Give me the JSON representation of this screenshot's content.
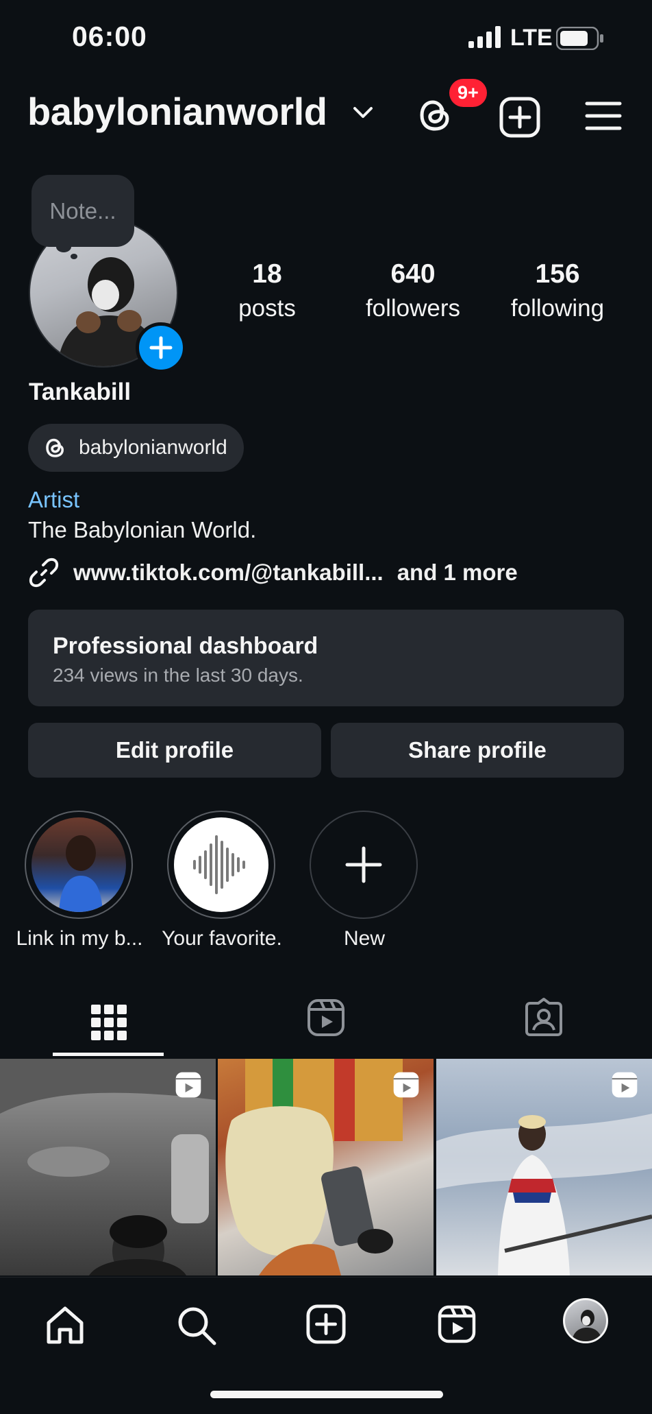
{
  "status_bar": {
    "time": "06:00",
    "network": "LTE",
    "icons": [
      "cellular-signal-icon",
      "battery-icon"
    ]
  },
  "header": {
    "username": "babylonianworld",
    "notification_count": "9+",
    "icons": [
      "chevron-down-icon",
      "threads-icon",
      "new-post-icon",
      "menu-icon"
    ]
  },
  "profile": {
    "note_placeholder": "Note...",
    "stats": [
      {
        "value": "18",
        "label": "posts"
      },
      {
        "value": "640",
        "label": "followers"
      },
      {
        "value": "156",
        "label": "following"
      }
    ],
    "display_name": "Tankabill",
    "threads_handle": "babylonianworld",
    "category": "Artist",
    "bio": "The Babylonian World.",
    "link_text": "www.tiktok.com/@tankabill...",
    "link_more": "and 1 more"
  },
  "dashboard": {
    "title": "Professional dashboard",
    "subtitle": "234 views in the last 30 days."
  },
  "buttons": {
    "edit_profile": "Edit profile",
    "share_profile": "Share profile"
  },
  "highlights": [
    {
      "label": "Link in my b..."
    },
    {
      "label": "Your favorite."
    },
    {
      "label": "New"
    }
  ],
  "tabs": [
    "posts-grid",
    "reels",
    "tagged"
  ],
  "bottom_nav": [
    "home",
    "search",
    "create",
    "reels",
    "profile"
  ],
  "colors": {
    "background": "#0c1014",
    "surface": "#262a30",
    "accent_blue": "#0095f6",
    "link_blue": "#79c4ff",
    "badge_red": "#ff2134"
  }
}
